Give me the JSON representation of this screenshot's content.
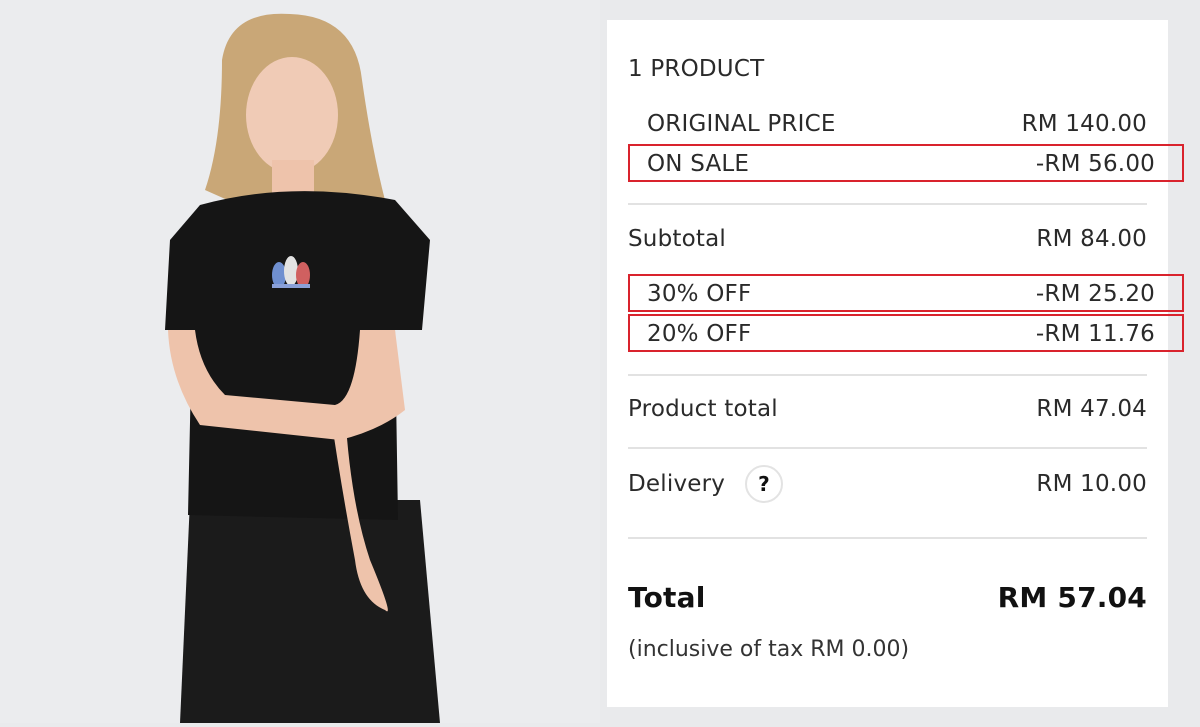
{
  "summary": {
    "product_count": "1 PRODUCT",
    "original_price_label": "ORIGINAL PRICE",
    "original_price_value": "RM 140.00",
    "on_sale_label": "ON SALE",
    "on_sale_value": "-RM 56.00",
    "subtotal_label": "Subtotal",
    "subtotal_value": "RM 84.00",
    "discount1_label": "30% OFF",
    "discount1_value": "-RM 25.20",
    "discount2_label": "20% OFF",
    "discount2_value": "-RM 11.76",
    "product_total_label": "Product total",
    "product_total_value": "RM 47.04",
    "delivery_label": "Delivery",
    "delivery_help": "?",
    "delivery_value": "RM 10.00",
    "total_label": "Total",
    "total_value": "RM 57.04",
    "tax_note": "(inclusive of tax RM 0.00)"
  },
  "colors": {
    "highlight_border": "#d9232d",
    "background": "#e9eaec",
    "card": "#ffffff",
    "shirt": "#151515"
  },
  "icons": {
    "help": "question-circle-icon",
    "logo": "trefoil-logo"
  }
}
